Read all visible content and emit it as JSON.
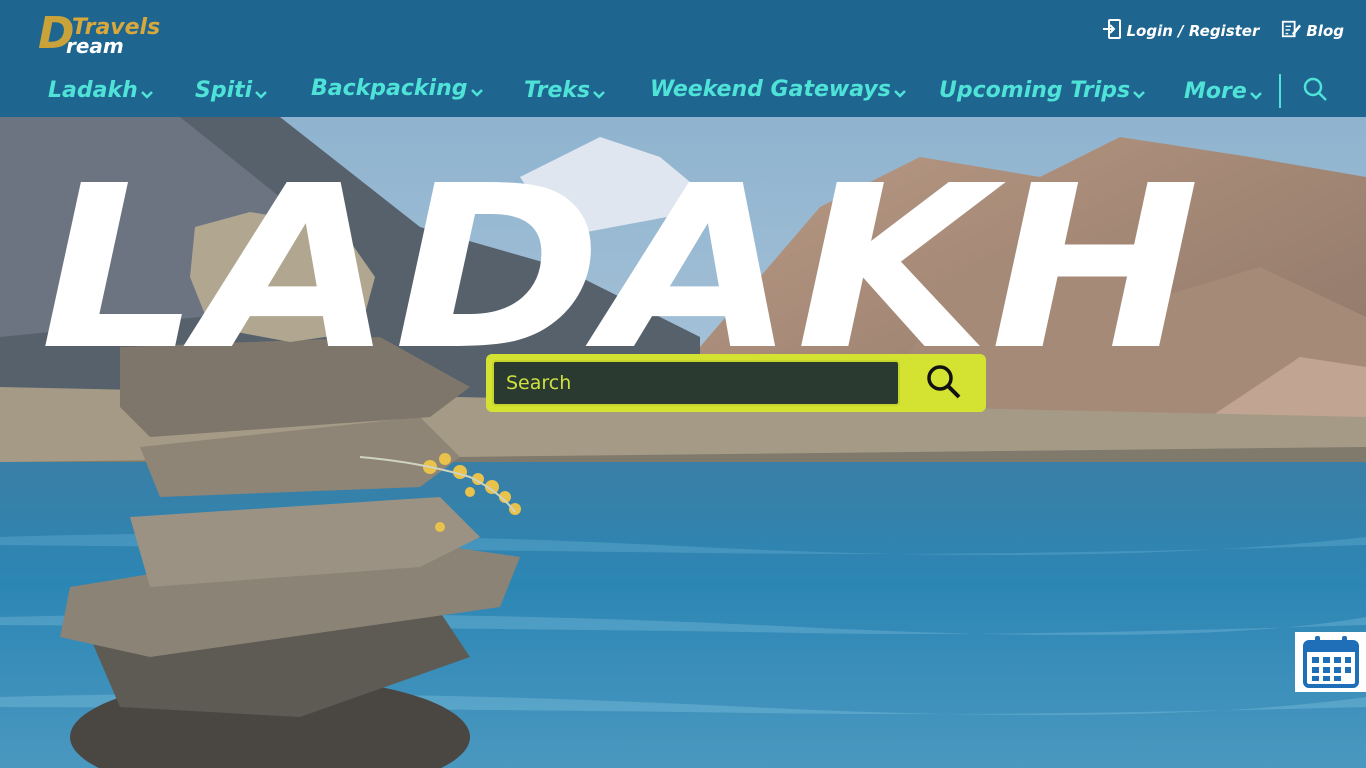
{
  "brand": {
    "logo_d": "D",
    "logo_travels": "Travels",
    "logo_ream": "ream",
    "colors": {
      "header": "#1e6590",
      "nav_text": "#4fe3d8",
      "logo_gold": "#c9a23a",
      "search_accent": "#d4e231"
    }
  },
  "top_links": {
    "login_label": "Login / Register",
    "login_icon": "login-icon",
    "blog_label": "Blog",
    "blog_icon": "edit-icon"
  },
  "nav": {
    "items": [
      {
        "label": "Ladakh"
      },
      {
        "label": "Spiti"
      },
      {
        "label": "Backpacking"
      },
      {
        "label": "Treks"
      },
      {
        "label": "Weekend Gateways"
      },
      {
        "label": "Upcoming Trips"
      },
      {
        "label": "More"
      }
    ],
    "search_icon": "search-icon"
  },
  "hero": {
    "title": "LADAKH",
    "search": {
      "placeholder": "Search"
    },
    "calendar_icon": "calendar-icon"
  }
}
